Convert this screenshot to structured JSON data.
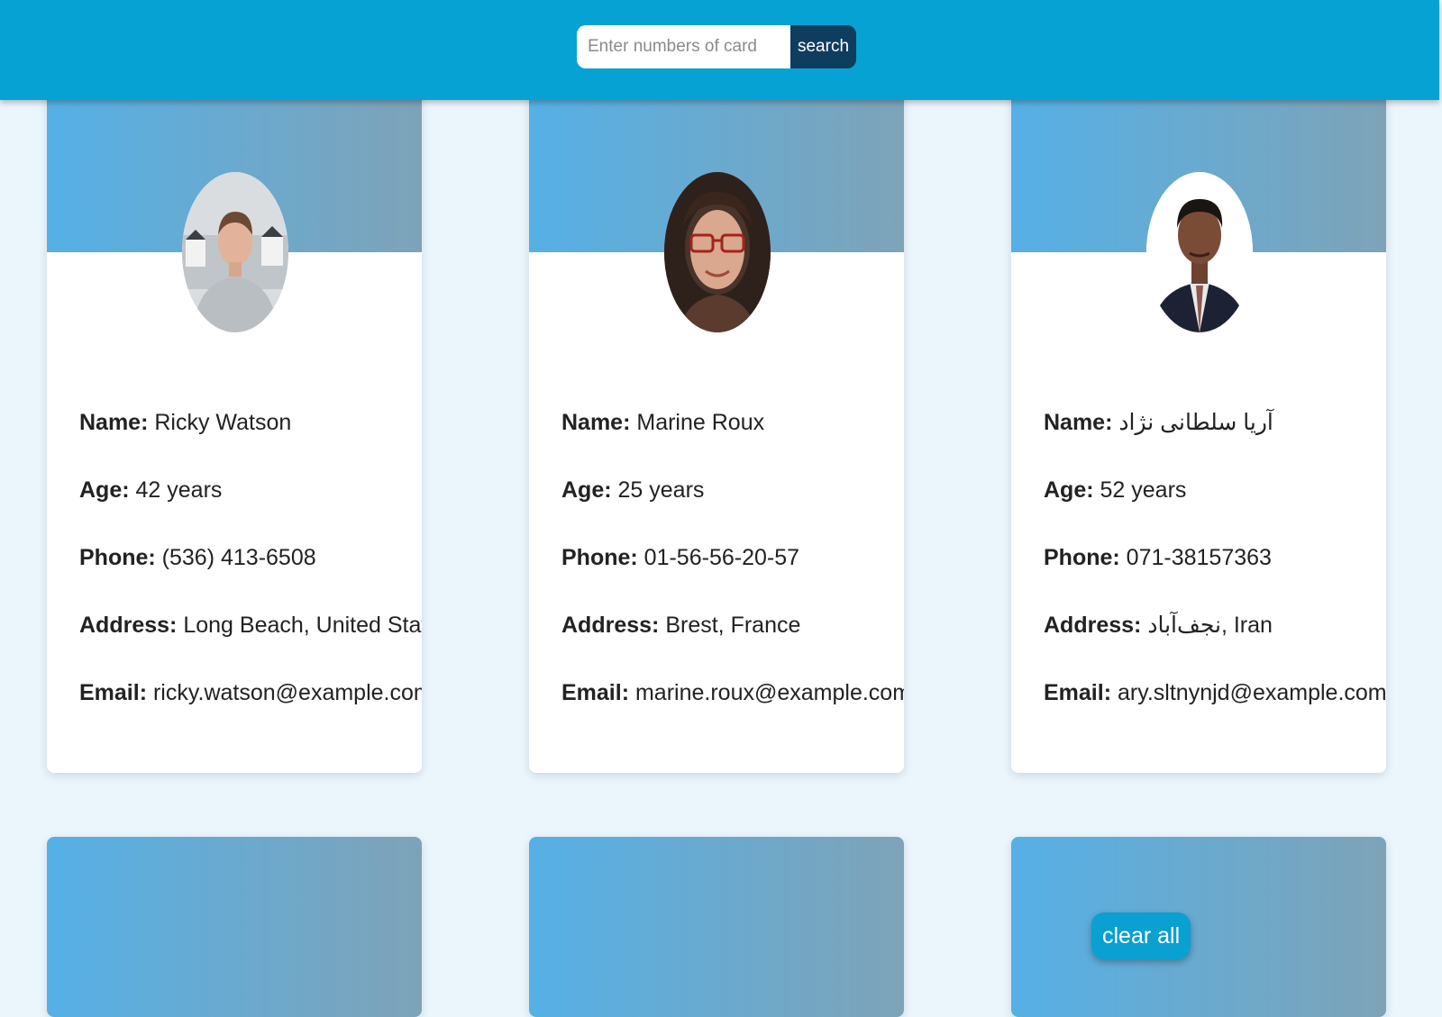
{
  "search": {
    "placeholder": "Enter numbers of card",
    "button_label": "search"
  },
  "field_labels": {
    "name": "Name:",
    "age": "Age:",
    "phone": "Phone:",
    "address": "Address:",
    "email": "Email:"
  },
  "cards": [
    {
      "name": "Ricky Watson",
      "age": "42 years",
      "phone": "(536) 413-6508",
      "address": "Long Beach, United States",
      "email": "ricky.watson@example.com"
    },
    {
      "name": "Marine Roux",
      "age": "25 years",
      "phone": "01-56-56-20-57",
      "address": "Brest, France",
      "email": "marine.roux@example.com"
    },
    {
      "name": "آریا سلطانی نژاد",
      "age": "52 years",
      "phone": "071-38157363",
      "address": "نجف‌آباد, Iran",
      "email": "ary.sltnynjd@example.com"
    }
  ],
  "clear_all_label": "clear all",
  "colors": {
    "topbar": "#07a2d4",
    "search_button": "#0f3d5e",
    "card_header_start": "#55b0e6",
    "card_header_end": "#7ea3b8",
    "background": "#eaf5fc"
  }
}
